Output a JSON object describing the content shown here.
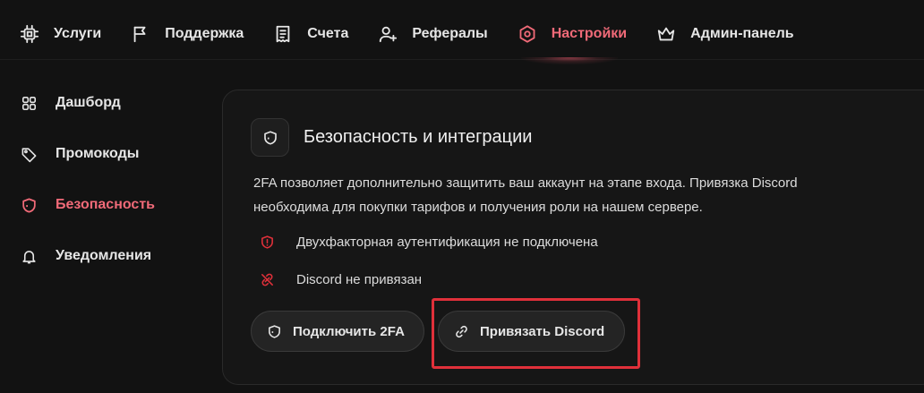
{
  "nav": {
    "items": [
      {
        "label": "Услуги",
        "icon": "chip-icon"
      },
      {
        "label": "Поддержка",
        "icon": "flag-icon"
      },
      {
        "label": "Счета",
        "icon": "receipt-icon"
      },
      {
        "label": "Рефералы",
        "icon": "user-plus-icon"
      },
      {
        "label": "Настройки",
        "icon": "settings-icon",
        "active": true
      },
      {
        "label": "Админ-панель",
        "icon": "crown-icon"
      }
    ]
  },
  "sidebar": {
    "items": [
      {
        "label": "Дашборд",
        "icon": "grid-icon"
      },
      {
        "label": "Промокоды",
        "icon": "tag-icon"
      },
      {
        "label": "Безопасность",
        "icon": "shield-icon",
        "active": true
      },
      {
        "label": "Уведомления",
        "icon": "bell-icon"
      }
    ]
  },
  "card": {
    "title": "Безопасность и интеграции",
    "description": "2FA позволяет дополнительно защитить ваш аккаунт на этапе входа. Привязка Discord необходима для покупки тарифов и получения роли на нашем сервере.",
    "status_2fa": "Двухфакторная аутентификация не подключена",
    "status_discord": "Discord не привязан",
    "btn_2fa": "Подключить 2FA",
    "btn_discord": "Привязать Discord"
  },
  "colors": {
    "accent": "#f06a78",
    "alert": "#e0303a",
    "background": "#121212",
    "card": "#161616"
  }
}
